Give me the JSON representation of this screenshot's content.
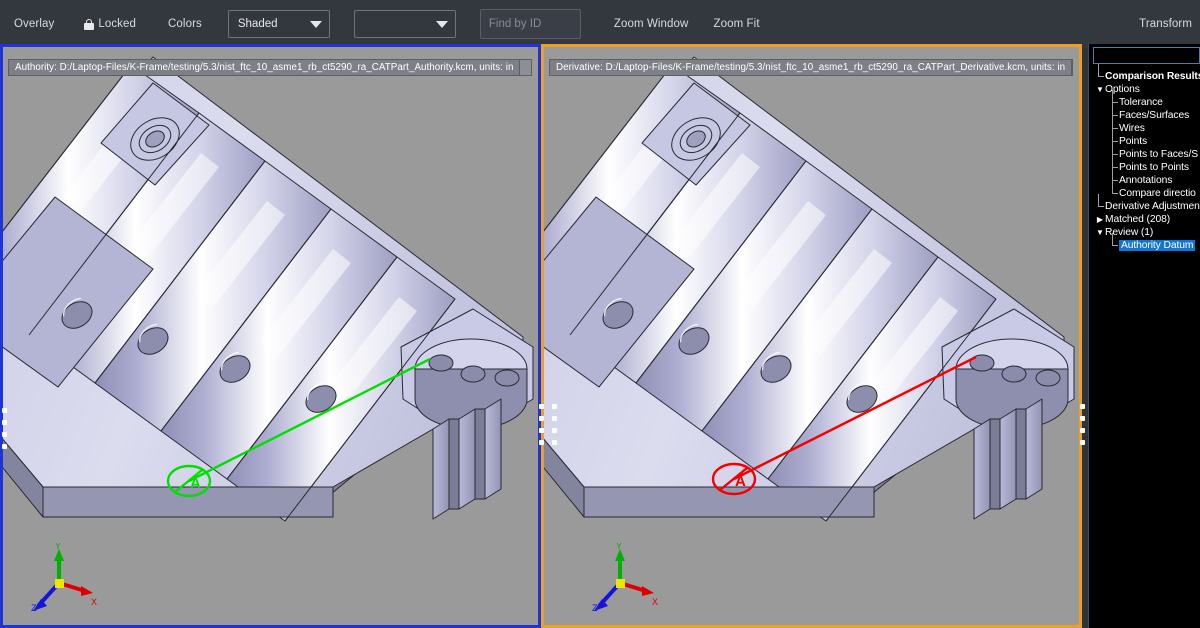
{
  "toolbar": {
    "overlay_label": "Overlay",
    "locked_label": "Locked",
    "lock_icon": "lock-icon",
    "colors_label": "Colors",
    "display_mode": {
      "value": "Shaded",
      "caret_icon": "chevron-down-icon"
    },
    "secondary_select": {
      "value": "",
      "caret_icon": "chevron-down-icon"
    },
    "find_by_id": {
      "value": "",
      "placeholder": "Find by ID"
    },
    "zoom_window_label": "Zoom Window",
    "zoom_fit_label": "Zoom Fit",
    "transform_label": "Transform"
  },
  "left_pane": {
    "border_color": "#1f33d8",
    "label": "Authority:  D:/Laptop-Files/K-Frame/testing/5.3/nist_ftc_10_asme1_rb_ct5290_ra_CATPart_Authority.kcm, units: in",
    "annotation_color": "#00e000",
    "annotation_symbol": "A",
    "axis_labels": {
      "x": "X",
      "y": "Y",
      "z": "Z"
    }
  },
  "right_pane": {
    "border_color": "#f0a020",
    "label": "Derivative:  D:/Laptop-Files/K-Frame/testing/5.3/nist_ftc_10_asme1_rb_ct5290_ra_CATPart_Derivative.kcm, units: in",
    "annotation_color": "#f40000",
    "annotation_symbol": "A",
    "axis_labels": {
      "x": "X",
      "y": "Y",
      "z": "Z"
    }
  },
  "tree_panel": {
    "search": {
      "value": "",
      "placeholder": ""
    },
    "selected_color": "#1276d0",
    "items": [
      {
        "label": "Comparison Results",
        "indent": 0,
        "twisty": "",
        "bold": true,
        "selected": false,
        "elbow": true
      },
      {
        "label": "Options",
        "indent": 0,
        "twisty": "▼",
        "bold": false,
        "selected": false,
        "elbow": false
      },
      {
        "label": "Tolerance",
        "indent": 1,
        "twisty": "",
        "bold": false,
        "selected": false,
        "elbow": true
      },
      {
        "label": "Faces/Surfaces",
        "indent": 1,
        "twisty": "",
        "bold": false,
        "selected": false,
        "elbow": true
      },
      {
        "label": "Wires",
        "indent": 1,
        "twisty": "",
        "bold": false,
        "selected": false,
        "elbow": true
      },
      {
        "label": "Points",
        "indent": 1,
        "twisty": "",
        "bold": false,
        "selected": false,
        "elbow": true
      },
      {
        "label": "Points to Faces/S",
        "indent": 1,
        "twisty": "",
        "bold": false,
        "selected": false,
        "elbow": true
      },
      {
        "label": "Points to Points",
        "indent": 1,
        "twisty": "",
        "bold": false,
        "selected": false,
        "elbow": true
      },
      {
        "label": "Annotations",
        "indent": 1,
        "twisty": "",
        "bold": false,
        "selected": false,
        "elbow": true
      },
      {
        "label": "Compare directio",
        "indent": 1,
        "twisty": "",
        "bold": false,
        "selected": false,
        "elbow": true
      },
      {
        "label": "Derivative Adjustmen",
        "indent": 0,
        "twisty": "",
        "bold": false,
        "selected": false,
        "elbow": true
      },
      {
        "label": "Matched (208)",
        "indent": 0,
        "twisty": "▶",
        "bold": false,
        "selected": false,
        "elbow": false
      },
      {
        "label": "Review (1)",
        "indent": 0,
        "twisty": "▼",
        "bold": false,
        "selected": false,
        "elbow": false
      },
      {
        "label": "Authority Datum",
        "indent": 1,
        "twisty": "",
        "bold": false,
        "selected": true,
        "elbow": true
      }
    ]
  }
}
